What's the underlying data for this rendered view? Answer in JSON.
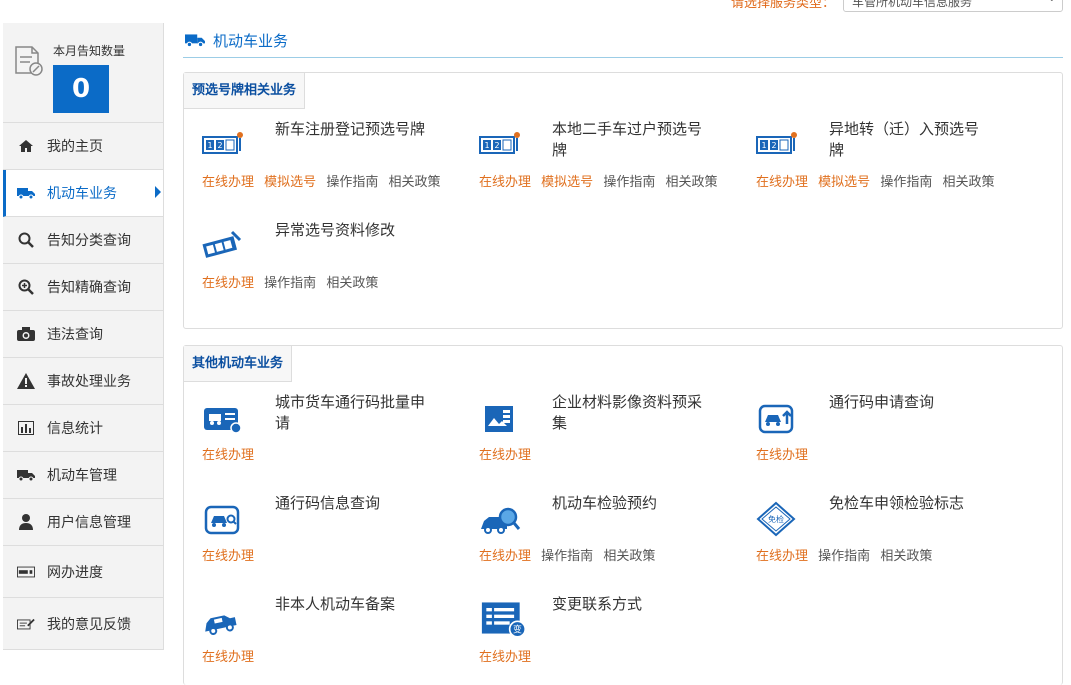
{
  "top": {
    "prompt": "请选择服务类型：",
    "select_value": "车管所机动车信息服务"
  },
  "sidebar": {
    "notice_label": "本月告知数量",
    "notice_count": "0",
    "items": [
      {
        "label": "我的主页",
        "icon": "home-icon"
      },
      {
        "label": "机动车业务",
        "icon": "truck-icon",
        "active": true
      },
      {
        "label": "告知分类查询",
        "icon": "search-icon"
      },
      {
        "label": "告知精确查询",
        "icon": "zoom-icon"
      },
      {
        "label": "违法查询",
        "icon": "camera-icon"
      },
      {
        "label": "事故处理业务",
        "icon": "warning-icon"
      },
      {
        "label": "信息统计",
        "icon": "chart-icon"
      },
      {
        "label": "机动车管理",
        "icon": "truck-icon"
      },
      {
        "label": "用户信息管理",
        "icon": "user-icon"
      },
      {
        "label": "网办进度",
        "icon": "progress-icon"
      },
      {
        "label": "我的意见反馈",
        "icon": "feedback-icon"
      }
    ]
  },
  "main": {
    "title": "机动车业务",
    "section1": {
      "title": "预选号牌相关业务",
      "services": [
        {
          "name": "新车注册登记预选号牌",
          "links": [
            "在线办理",
            "模拟选号",
            "操作指南",
            "相关政策"
          ]
        },
        {
          "name": "本地二手车过户预选号牌",
          "links": [
            "在线办理",
            "模拟选号",
            "操作指南",
            "相关政策"
          ]
        },
        {
          "name": "异地转（迁）入预选号牌",
          "links": [
            "在线办理",
            "模拟选号",
            "操作指南",
            "相关政策"
          ]
        },
        {
          "name": "异常选号资料修改",
          "links": [
            "在线办理",
            "操作指南",
            "相关政策"
          ]
        }
      ]
    },
    "section2": {
      "title": "其他机动车业务",
      "services": [
        {
          "name": "城市货车通行码批量申请",
          "links": [
            "在线办理"
          ]
        },
        {
          "name": "企业材料影像资料预采集",
          "links": [
            "在线办理"
          ]
        },
        {
          "name": "通行码申请查询",
          "links": [
            "在线办理"
          ]
        },
        {
          "name": "通行码信息查询",
          "links": [
            "在线办理"
          ]
        },
        {
          "name": "机动车检验预约",
          "links": [
            "在线办理",
            "操作指南",
            "相关政策"
          ]
        },
        {
          "name": "免检车申领检验标志",
          "links": [
            "在线办理",
            "操作指南",
            "相关政策"
          ],
          "badge": "免检"
        },
        {
          "name": "非本人机动车备案",
          "links": [
            "在线办理"
          ]
        },
        {
          "name": "变更联系方式",
          "links": [
            "在线办理"
          ],
          "badge": "变"
        }
      ]
    }
  },
  "colors": {
    "accent": "#0b6bc7",
    "link_orange": "#e0701f",
    "link_gray": "#555555"
  }
}
